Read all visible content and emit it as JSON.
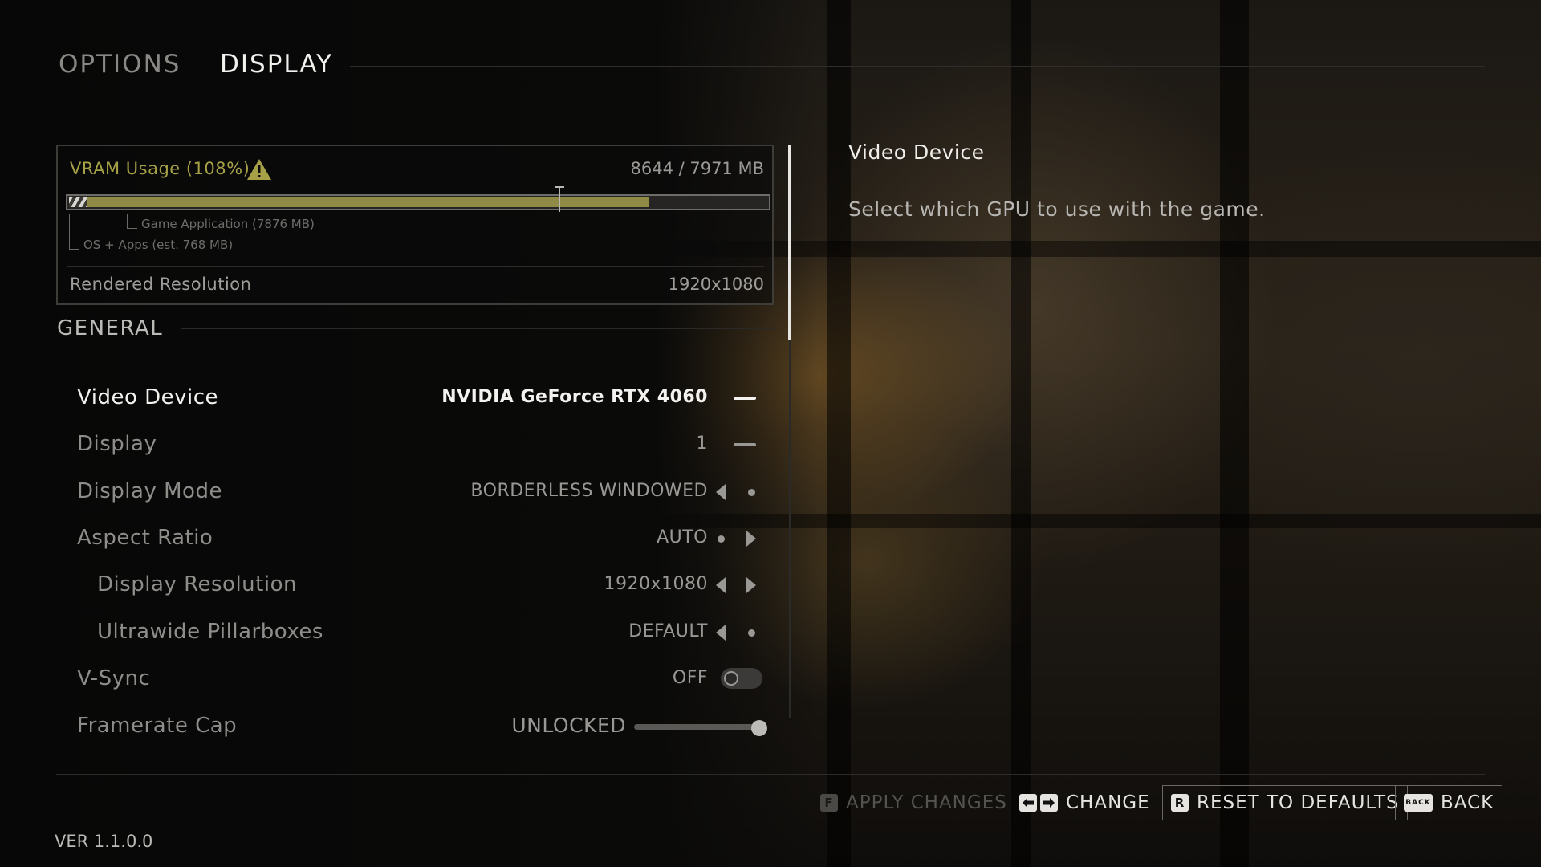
{
  "header": {
    "breadcrumb_parent": "OPTIONS",
    "breadcrumb_current": "DISPLAY"
  },
  "vram": {
    "title": "VRAM Usage (108%)",
    "usage_text": "8644 / 7971 MB",
    "used_mb": 8644,
    "total_mb": 7971,
    "game_mb": 7876,
    "os_mb": 768,
    "game_label": "Game Application (7876 MB)",
    "os_label": "OS + Apps (est. 768 MB)",
    "warning_icon": "warning-triangle-icon",
    "accent_color": "#a6a146",
    "rendered_resolution_label": "Rendered Resolution",
    "rendered_resolution_value": "1920x1080"
  },
  "section": {
    "title": "GENERAL"
  },
  "settings": [
    {
      "label": "Video Device",
      "value": "NVIDIA GeForce RTX 4060",
      "control": "dash",
      "active": true
    },
    {
      "label": "Display",
      "value": "1",
      "control": "dash"
    },
    {
      "label": "Display Mode",
      "value": "BORDERLESS WINDOWED",
      "control": "arrow-left-dot"
    },
    {
      "label": "Aspect Ratio",
      "value": "AUTO",
      "control": "dot-arrow-right"
    },
    {
      "label": "Display Resolution",
      "value": "1920x1080",
      "control": "arrows",
      "indent": true
    },
    {
      "label": "Ultrawide Pillarboxes",
      "value": "DEFAULT",
      "control": "arrow-left-dot",
      "indent": true
    },
    {
      "label": "V-Sync",
      "value": "OFF",
      "control": "toggle",
      "toggle_on": false
    },
    {
      "label": "Framerate Cap",
      "value": "UNLOCKED",
      "control": "slider",
      "slider_fraction": 1.0
    }
  ],
  "info": {
    "title": "Video Device",
    "description": "Select which GPU to use with the game."
  },
  "footer": {
    "apply_key": "F",
    "apply_label": "APPLY CHANGES",
    "change_label": "CHANGE",
    "change_icons": [
      "arrow-left-key-icon",
      "arrow-right-key-icon"
    ],
    "reset_key": "R",
    "reset_label": "RESET TO DEFAULTS",
    "back_key": "BACK",
    "back_label": "BACK"
  },
  "version": "VER 1.1.0.0"
}
